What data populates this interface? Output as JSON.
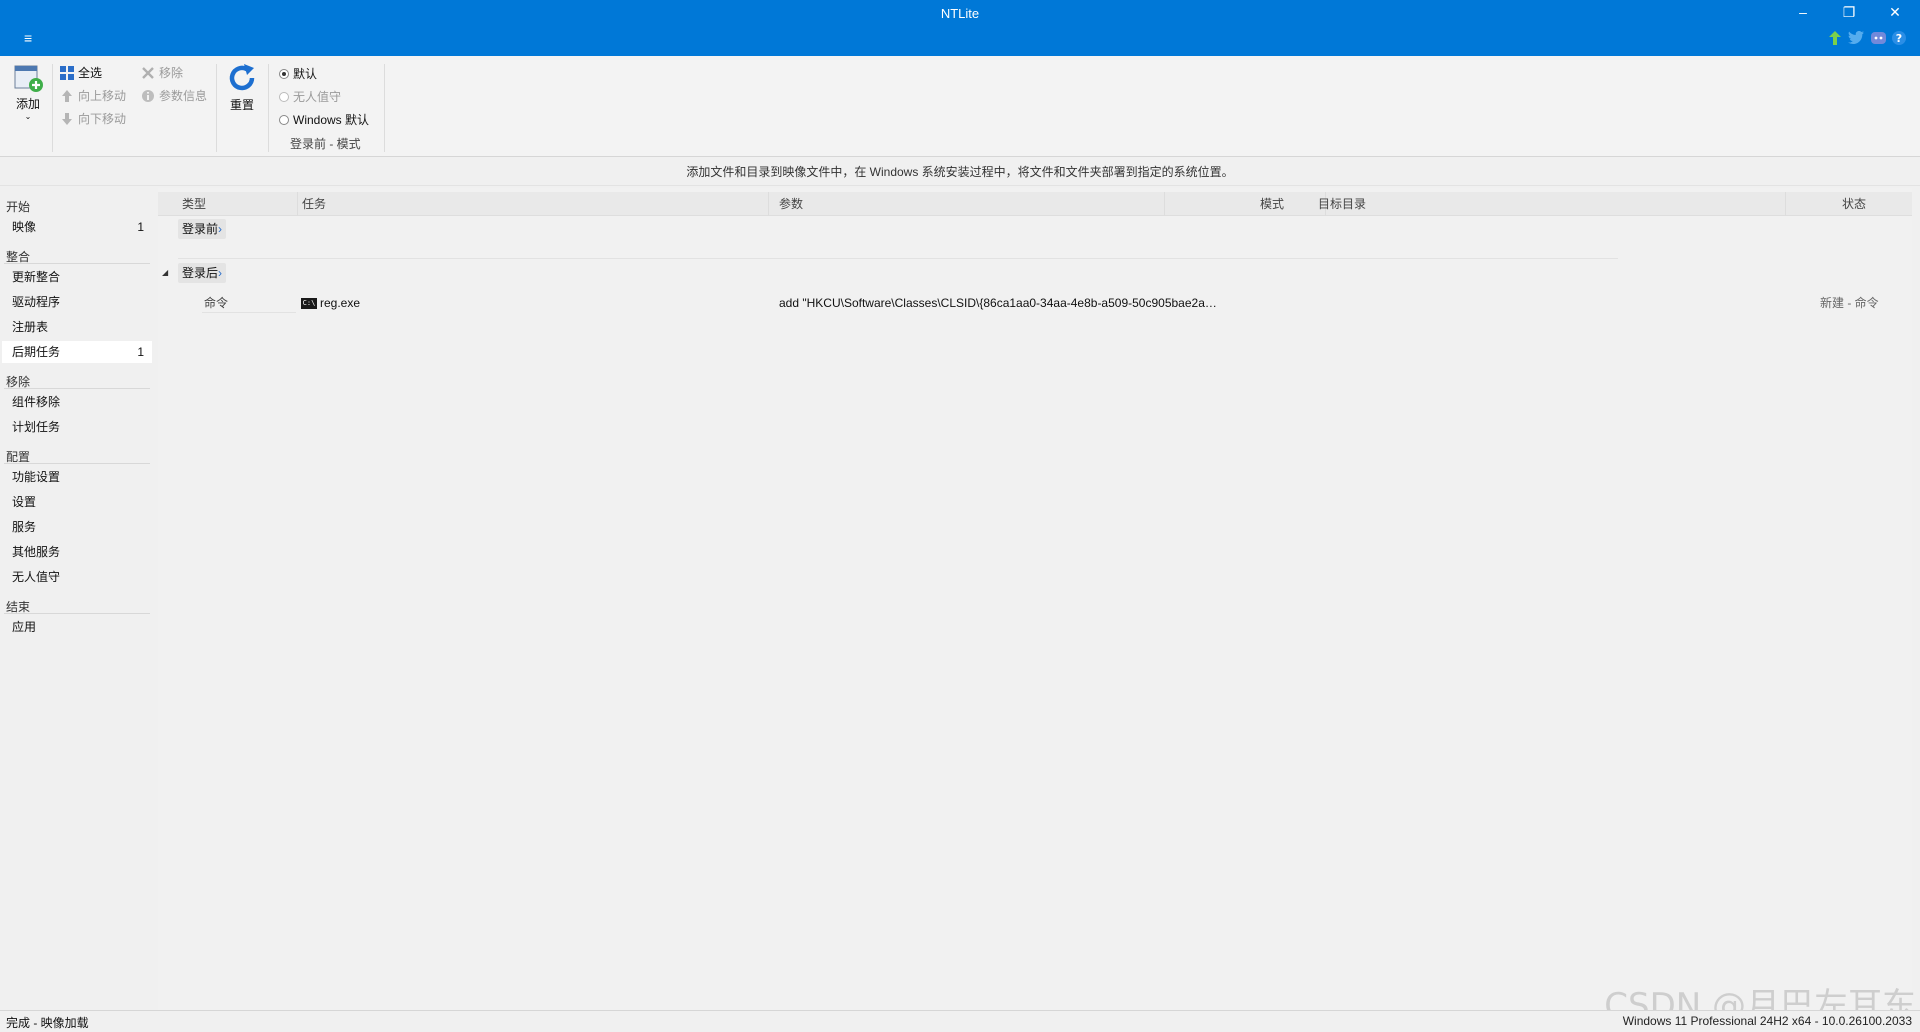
{
  "window": {
    "title": "NTLite",
    "menu_glyph": "≡",
    "controls": {
      "minimize": "–",
      "restore": "❐",
      "close": "✕"
    },
    "social_icons": [
      "update-icon",
      "twitter-icon",
      "discord-icon",
      "help-icon"
    ],
    "accent": "#0078d7"
  },
  "ribbon": {
    "add_label": "添加",
    "select_all_label": "全选",
    "move_up_label": "向上移动",
    "move_down_label": "向下移动",
    "remove_label": "移除",
    "param_info_label": "参数信息",
    "reset_label": "重置",
    "mode_options": [
      {
        "label": "默认",
        "checked": true,
        "enabled": true
      },
      {
        "label": "无人值守",
        "checked": false,
        "enabled": false
      },
      {
        "label": "Windows 默认",
        "checked": false,
        "enabled": true
      }
    ],
    "mode_group_label": "登录前 - 模式"
  },
  "description": "添加文件和目录到映像文件中，在 Windows 系统安装过程中，将文件和文件夹部署到指定的系统位置。",
  "sidebar": {
    "categories": [
      {
        "label": "开始",
        "items": [
          {
            "label": "映像",
            "count": "1",
            "active": false
          }
        ]
      },
      {
        "label": "整合",
        "items": [
          {
            "label": "更新整合",
            "count": "",
            "active": false
          },
          {
            "label": "驱动程序",
            "count": "",
            "active": false
          },
          {
            "label": "注册表",
            "count": "",
            "active": false
          },
          {
            "label": "后期任务",
            "count": "1",
            "active": true
          }
        ]
      },
      {
        "label": "移除",
        "items": [
          {
            "label": "组件移除",
            "count": "",
            "active": false
          },
          {
            "label": "计划任务",
            "count": "",
            "active": false
          }
        ]
      },
      {
        "label": "配置",
        "items": [
          {
            "label": "功能设置",
            "count": "",
            "active": false
          },
          {
            "label": "设置",
            "count": "",
            "active": false
          },
          {
            "label": "服务",
            "count": "",
            "active": false
          },
          {
            "label": "其他服务",
            "count": "",
            "active": false
          },
          {
            "label": "无人值守",
            "count": "",
            "active": false
          }
        ]
      },
      {
        "label": "结束",
        "items": [
          {
            "label": "应用",
            "count": "",
            "active": false
          }
        ]
      }
    ]
  },
  "table": {
    "columns": [
      "类型",
      "任务",
      "参数",
      "模式",
      "目标目录",
      "状态"
    ],
    "groups": [
      {
        "label": "登录前",
        "rows": []
      },
      {
        "label": "登录后",
        "rows": [
          {
            "type": "命令",
            "task": "reg.exe",
            "params": "add \"HKCU\\Software\\Classes\\CLSID\\{86ca1aa0-34aa-4e8b-a509-50c905bae2a…",
            "mode": "",
            "target": "",
            "status": "新建 - 命令"
          }
        ]
      }
    ]
  },
  "statusbar": {
    "left": "完成 - 映像加载",
    "right": "Windows 11 Professional 24H2 x64 - 10.0.26100.2033"
  },
  "watermark": "CSDN @月巴左耳东"
}
